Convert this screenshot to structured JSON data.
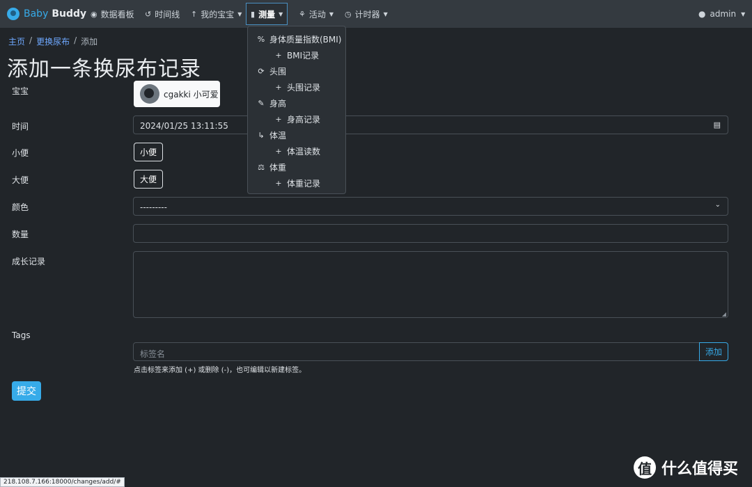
{
  "nav": {
    "brand_first": "Baby",
    "brand_second": "Buddy",
    "items": [
      {
        "icon": "dashboard-icon",
        "label": "数据看板"
      },
      {
        "icon": "history-icon",
        "label": "时间线"
      },
      {
        "icon": "baby-icon",
        "label": "我的宝宝"
      },
      {
        "icon": "clipboard-icon",
        "label": "测量"
      },
      {
        "icon": "activities-icon",
        "label": "活动"
      },
      {
        "icon": "timer-icon",
        "label": "计时器"
      }
    ],
    "user": "admin"
  },
  "dropdown": {
    "items": [
      {
        "label": "身体质量指数(BMI)",
        "icon": "percent-icon"
      },
      {
        "label": "BMI记录",
        "icon": "plus-icon"
      },
      {
        "label": "头围",
        "icon": "head-circumference-icon"
      },
      {
        "label": "头围记录",
        "icon": "plus-icon"
      },
      {
        "label": "身高",
        "icon": "ruler-icon"
      },
      {
        "label": "身高记录",
        "icon": "plus-icon"
      },
      {
        "label": "体温",
        "icon": "thermometer-icon"
      },
      {
        "label": "体温读数",
        "icon": "plus-icon"
      },
      {
        "label": "体重",
        "icon": "scale-icon"
      },
      {
        "label": "体重记录",
        "icon": "plus-icon"
      }
    ]
  },
  "breadcrumb": {
    "home": "主页",
    "section": "更换尿布",
    "current": "添加"
  },
  "page_title": "添加一条换尿布记录",
  "form": {
    "child_label": "宝宝",
    "child_name": "cgakki 小可爱",
    "time_label": "时间",
    "time_value": "2024/01/25 13:11:55",
    "wet_label": "小便",
    "wet_button": "小便",
    "solid_label": "大便",
    "solid_button": "大便",
    "color_label": "颜色",
    "color_value": "---------",
    "amount_label": "数量",
    "notes_label": "成长记录",
    "tags_label": "Tags",
    "tags_placeholder": "标签名",
    "tags_add": "添加",
    "tags_help": "点击标签来添加 (+) 或删除 (-)，也可编辑以新建标签。",
    "submit": "提交"
  },
  "status_url": "218.108.7.166:18000/changes/add/#",
  "watermark": {
    "glyph": "值",
    "text": "什么值得买"
  }
}
